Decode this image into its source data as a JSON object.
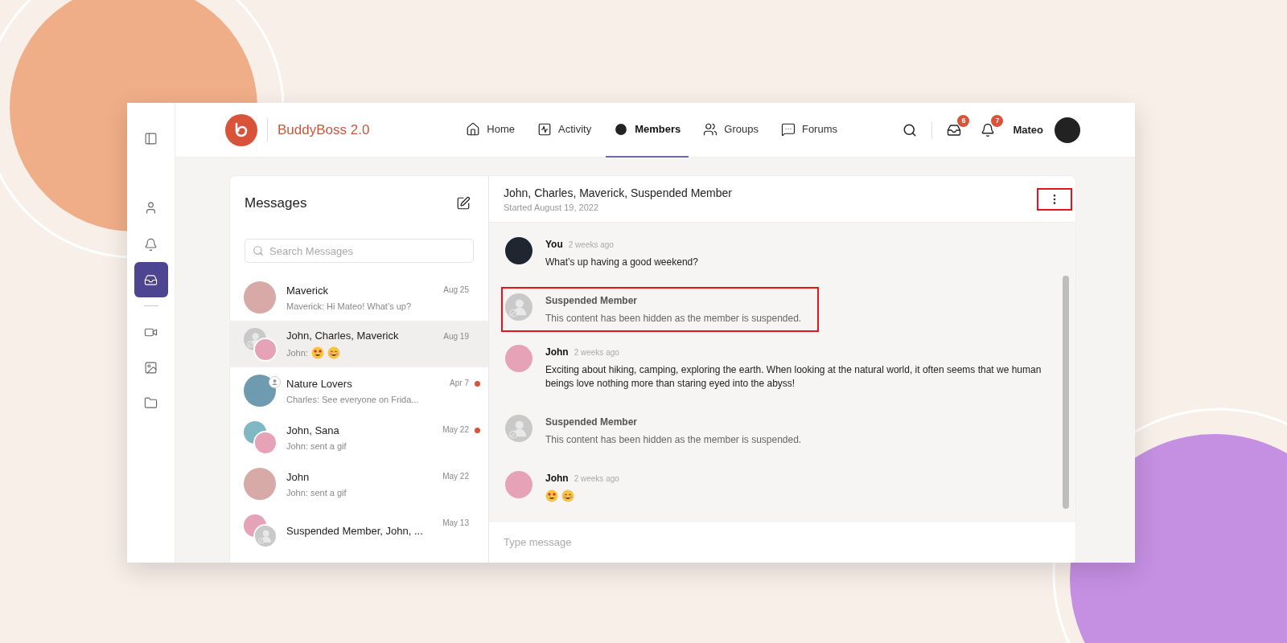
{
  "brand": {
    "name": "BuddyBoss 2.0"
  },
  "sidebar": {
    "items": [
      {
        "kind": "panel",
        "selected": false
      },
      {
        "kind": "profile",
        "selected": false
      },
      {
        "kind": "notifications",
        "selected": false
      },
      {
        "kind": "messages",
        "selected": true
      },
      {
        "kind": "video",
        "selected": false
      },
      {
        "kind": "photos",
        "selected": false
      },
      {
        "kind": "documents",
        "selected": false
      }
    ]
  },
  "nav": [
    {
      "label": "Home",
      "kind": "home",
      "selected": false
    },
    {
      "label": "Activity",
      "kind": "activity",
      "selected": false
    },
    {
      "label": "Members",
      "kind": "members",
      "selected": true
    },
    {
      "label": "Groups",
      "kind": "groups",
      "selected": false
    },
    {
      "label": "Forums",
      "kind": "forums",
      "selected": false
    }
  ],
  "header_actions": {
    "messages_badge": "6",
    "notifications_badge": "7",
    "user_name": "Mateo"
  },
  "messages_panel": {
    "title": "Messages",
    "search": {
      "placeholder": "Search Messages"
    },
    "conversations": [
      {
        "kind": "text",
        "name": "Maverick",
        "preview": "Maverick: Hi Mateo! What’s up?",
        "date": "Aug 25",
        "avatar": {
          "kind": "single"
        },
        "selected": false,
        "unread": false
      },
      {
        "kind": "emoji",
        "name": "John, Charles, Maverick",
        "preview": "John:",
        "date": "Aug 19",
        "avatar": {
          "kind": "pair-suspended"
        },
        "selected": true,
        "unread": false
      },
      {
        "kind": "text",
        "name": "Nature Lovers",
        "preview": "Charles: See everyone on Frida...",
        "date": "Apr 7",
        "avatar": {
          "kind": "group"
        },
        "selected": false,
        "unread": true
      },
      {
        "kind": "text",
        "name": "John, Sana",
        "preview": "John: sent a gif",
        "date": "May 22",
        "avatar": {
          "kind": "pair"
        },
        "selected": false,
        "unread": true
      },
      {
        "kind": "text",
        "name": "John",
        "preview": "John: sent a gif",
        "date": "May 22",
        "avatar": {
          "kind": "single"
        },
        "selected": false,
        "unread": false
      },
      {
        "kind": "none",
        "name": "Suspended Member, John, ...",
        "date": "May 13",
        "avatar": {
          "kind": "pair-suspended-front"
        },
        "selected": false,
        "unread": false
      }
    ]
  },
  "thread": {
    "title": "John, Charles, Maverick, Suspended Member",
    "started": "Started August 19, 2022",
    "more_highlighted": true,
    "messages": [
      {
        "kind": "text",
        "author": "You",
        "time": "2 weeks ago",
        "text": "What’s up having a good weekend?",
        "highlighted": false
      },
      {
        "kind": "suspended",
        "author": "Suspended Member",
        "text": "This content has been hidden as the member is suspended.",
        "highlighted": true
      },
      {
        "kind": "text",
        "author": "John",
        "time": "2 weeks ago",
        "text": "Exciting about hiking, camping, exploring the earth. When looking at the natural world, it often seems that we human beings love nothing more than staring eyed into the abyss!",
        "highlighted": false
      },
      {
        "kind": "suspended",
        "author": "Suspended Member",
        "text": "This content has been hidden as the member is suspended.",
        "highlighted": false
      },
      {
        "kind": "emoji",
        "author": "John",
        "time": "2 weeks ago",
        "highlighted": false
      }
    ],
    "composer": {
      "placeholder": "Type message"
    }
  }
}
